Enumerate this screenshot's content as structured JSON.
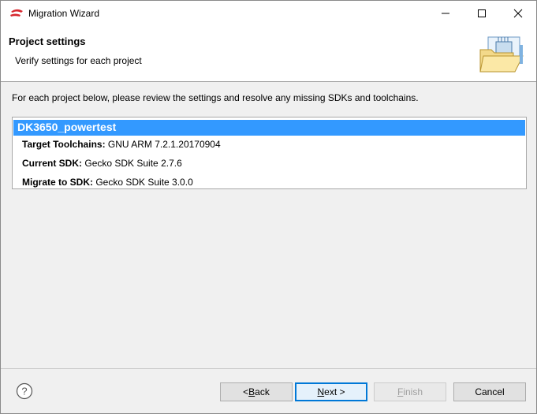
{
  "window": {
    "title": "Migration Wizard"
  },
  "header": {
    "title": "Project settings",
    "subtitle": "Verify settings for each project"
  },
  "content": {
    "instruction": "For each project below, please review the settings and resolve any missing SDKs and toolchains.",
    "project": {
      "name": "DK3650_powertest",
      "details": [
        {
          "label": "Target Toolchains:",
          "value": "GNU ARM 7.2.1.20170904"
        },
        {
          "label": "Current SDK:",
          "value": "Gecko SDK Suite 2.7.6"
        },
        {
          "label": "Migrate to SDK:",
          "value": "Gecko SDK Suite 3.0.0"
        }
      ]
    }
  },
  "buttons": {
    "back_mnemonic": "B",
    "back_rest": "ack",
    "back_prefix": "< ",
    "next_mnemonic": "N",
    "next_rest": "ext >",
    "finish_mnemonic": "F",
    "finish_rest": "inish",
    "cancel": "Cancel"
  },
  "icons": {
    "app_logo": "silabs-logo-icon",
    "help": "help-icon",
    "header_art": "folder-chip-icon"
  },
  "colors": {
    "selection": "#3399ff",
    "focus_border": "#0078d7",
    "logo_red": "#d7282f"
  }
}
